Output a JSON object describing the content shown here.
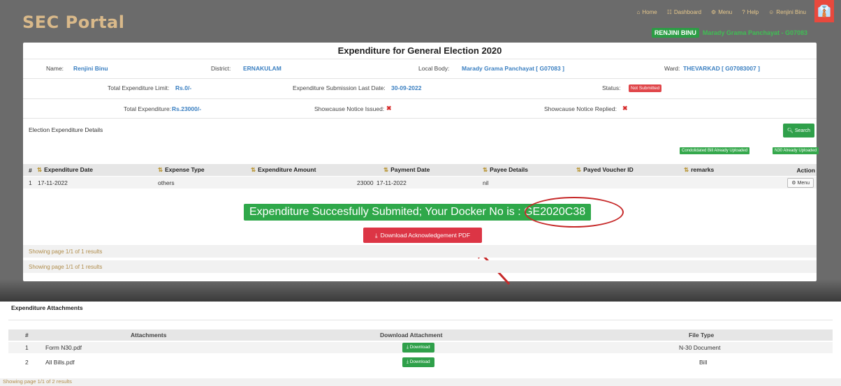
{
  "header": {
    "brand": "SEC Portal",
    "nav": [
      {
        "icon": "home-icon",
        "glyph": "⌂",
        "label": "Home"
      },
      {
        "icon": "dashboard-icon",
        "glyph": "☷",
        "label": "Dashboard"
      },
      {
        "icon": "menu-gear-icon",
        "glyph": "⚙",
        "label": "Menu"
      },
      {
        "icon": "help-icon",
        "glyph": "?",
        "label": "Help"
      },
      {
        "icon": "user-icon",
        "glyph": "☺",
        "label": "Renjini Binu"
      }
    ],
    "user_badge": "RENJINI BINU",
    "user_body": "Marady Grama Panchayat - G07083"
  },
  "expenditure": {
    "title": "Expenditure for General Election 2020",
    "name_label": "Name:",
    "name_value": "Renjini Binu",
    "district_label": "District:",
    "district_value": "ERNAKULAM",
    "local_body_label": "Local Body:",
    "local_body_value": "Marady Grama Panchayat [ G07083 ]",
    "ward_label": "Ward:",
    "ward_value": "THEVARKAD [ G07083007 ]",
    "limit_label": "Total Expenditure Limit:",
    "limit_value": "Rs.0/-",
    "last_date_label": "Expenditure Submission Last Date:",
    "last_date_value": "30-09-2022",
    "status_label": "Status:",
    "status_value": "Not Submitted",
    "total_label": "Total Expenditure:",
    "total_value": "Rs.23000/-",
    "notice_issued_label": "Showcause Notice Issued:",
    "notice_replied_label": "Showcause Notice Replied:"
  },
  "details": {
    "section_label": "Election Expenditure Details",
    "search_label": "Search",
    "chip_consolidated": "Condolidated Bill Already Uploaded",
    "chip_n30": "N30 Already Uploaded",
    "columns": {
      "hash": "#",
      "date": "Expenditure Date",
      "type": "Expense Type",
      "amount": "Expenditure Amount",
      "payment_date": "Payment Date",
      "payee": "Payee Details",
      "voucher": "Payed Voucher ID",
      "remarks": "remarks",
      "action": "Action"
    },
    "row": {
      "index": "1",
      "date": "17-11-2022",
      "type": "others",
      "amount": "23000",
      "payment_date": "17-11-2022",
      "payee": "nil",
      "voucher": "",
      "remarks": "",
      "action": "Menu"
    },
    "success_message": "Expenditure Succesfully Submited; Your Docker No is : GE2020C38",
    "download_ack": "Download Acknowledgement PDF",
    "paging_1": "Showing page 1/1 of 1 results",
    "paging_2": "Showing page 1/1 of 1 results"
  },
  "attachments": {
    "title": "Expenditure Attachments",
    "columns": {
      "hash": "#",
      "attachments": "Attachments",
      "download": "Download Attachment",
      "file_type": "File Type"
    },
    "rows": [
      {
        "index": "1",
        "name": "Form N30.pdf",
        "button": "Download",
        "file_type": "N-30 Document"
      },
      {
        "index": "2",
        "name": "All Bills.pdf",
        "button": "Download",
        "file_type": "Bill"
      }
    ],
    "paging": "Showing page 1/1 of 2 results"
  },
  "colors": {
    "accent_green": "#2fa04a",
    "danger_red": "#dc3545",
    "brand_gold": "#d9b98a",
    "annotation_red": "#c62828"
  }
}
